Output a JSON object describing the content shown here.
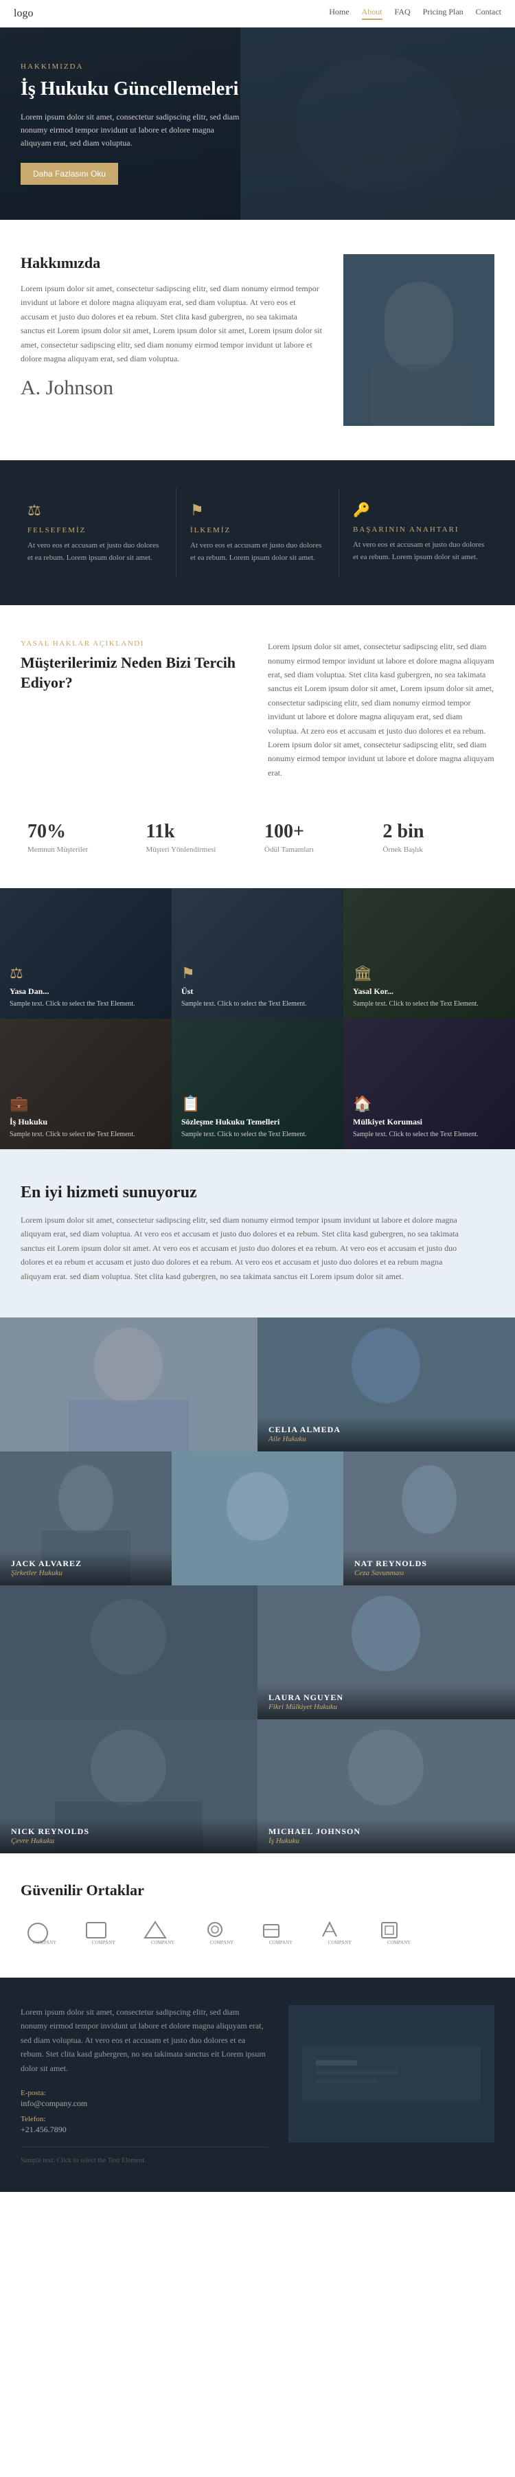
{
  "nav": {
    "logo": "logo",
    "links": [
      "Home",
      "About",
      "FAQ",
      "Pricing Plan",
      "Contact"
    ],
    "active": "About"
  },
  "hero": {
    "tag": "HAKKIMIZDA",
    "title": "İş Hukuku Güncellemeleri",
    "desc": "Lorem ipsum dolor sit amet, consectetur sadipscing elitr, sed diam nonumy eirmod tempor invidunt ut labore et dolore magna aliquyam erat, sed diam voluptua.",
    "btn": "Daha Fazlasını Oku"
  },
  "about": {
    "title": "Hakkımızda",
    "desc1": "Lorem ipsum dolor sit amet, consectetur sadipscing elitr, sed diam nonumy eirmod tempor invidunt ut labore et dolore magna aliquyam erat, sed diam voluptua. At vero eos et accusam et justo duo dolores et ea rebum. Stet clita kasd gubergren, no sea takimata sanctus eit Lorem ipsum dolor sit amet, Lorem ipsum dolor sit amet, Lorem ipsum dolor sit amet, consectetur sadipscing elitr, sed diam nonumy eirmod tempor invidunt ut labore et dolore magna aliquyam erat, sed diam voluptua.",
    "signature": "A. Johnson"
  },
  "pillars": [
    {
      "icon": "scale",
      "title": "FELSEFEMİZ",
      "desc": "At vero eos et accusam et justo duo dolores et ea rebum. Lorem ipsum dolor sit amet."
    },
    {
      "icon": "flag",
      "title": "İLKEMİZ",
      "desc": "At vero eos et accusam et justo duo dolores et ea rebum. Lorem ipsum dolor sit amet."
    },
    {
      "icon": "key",
      "title": "BAŞARININ ANAHTARI",
      "desc": "At vero eos et accusam et justo duo dolores et ea rebum. Lorem ipsum dolor sit amet."
    }
  ],
  "why": {
    "tag": "YASAL HAKLAR AÇIKLANDI",
    "title": "Müşterilerimiz Neden Bizi Tercih Ediyor?",
    "desc": "Lorem ipsum dolor sit amet, consectetur sadipscing elitr, sed diam nonumy eirmod tempor invidunt ut labore et dolore magna aliquyam erat, sed diam voluptua. Stet clita kasd gubergren, no sea takimata sanctus eit Lorem ipsum dolor sit amet, Lorem ipsum dolor sit amet, consectetur sadipscing elitr, sed diam nonumy eirmod tempor invidunt ut labore et dolore magna aliquyam erat, sed diam voluptua. At zero eos et accusam et justo duo dolores et ea rebum. Lorem ipsum dolor sit amet, consectetur sadipscing elitr, sed diam nonumy eirmod tempor invidunt ut labore et dolore magna aliquyam erat."
  },
  "stats": [
    {
      "number": "70%",
      "label": "Memnun Müşteriler"
    },
    {
      "number": "11k",
      "label": "Müşteri Yönlendirmesi"
    },
    {
      "number": "100+",
      "label": "Ödül Tamamları"
    },
    {
      "number": "2 bin",
      "label": "Örnek Başlık"
    }
  ],
  "grid_cards": [
    {
      "title": "Yasa Dan...",
      "sample": "Sample text. Click to select the Text Element.",
      "bg": "grid-bg-1",
      "icon": "⚖"
    },
    {
      "title": "Üst",
      "sample": "Sample text. Click to select the Text Element.",
      "bg": "grid-bg-2",
      "icon": "⚑"
    },
    {
      "title": "Yasal Kor...",
      "sample": "Sample text. Click to select the Text Element.",
      "bg": "grid-bg-3",
      "icon": "🏛"
    },
    {
      "title": "İş Hukuku",
      "sample": "Sample text. Click to select the Text Element.",
      "bg": "grid-bg-4",
      "icon": "💼"
    },
    {
      "title": "Sözleşme Hukuku Temelleri",
      "sample": "Sample text. Click to select the Text Element.",
      "bg": "grid-bg-5",
      "icon": "📋"
    },
    {
      "title": "Mülkiyet Korumasi",
      "sample": "Sample text. Click to select the Text Element.",
      "bg": "grid-bg-6",
      "icon": "🏠"
    }
  ],
  "services": {
    "title": "En iyi hizmeti sunuyoruz",
    "desc": "Lorem ipsum dolor sit amet, consectetur sadipscing elitr, sed diam nonumy eirmod tempor ipsum invidunt ut labore et dolore magna aliquyam erat, sed diam voluptua. At vero eos et accusam et justo duo dolores et ea rebum. Stet clita kasd gubergren, no sea takimata sanctus eit Lorem ipsum dolor sit amet. At vero eos et accusam et justo duo dolores et ea rebum. At vero eos et accusam et justo duo dolores et ea rebum et accusam et justo duo dolores et ea rebum. At vero eos et accusam et justo duo dolores et ea rebum magna aliquyam erat. sed diam voluptua. Stet clita kasd gubergren, no sea takimata sanctus eit Lorem ipsum dolor sit amet."
  },
  "team": [
    {
      "name": "CELIA ALMEDA",
      "role": "Aile Hukuku",
      "bg": "team-bg-1",
      "col": "right"
    },
    {
      "name": "JACK ALVAREZ",
      "role": "Şirketler Hukuku",
      "bg": "team-bg-2",
      "col": "left"
    },
    {
      "name": "NAT REYNOLDS",
      "role": "Ceza Savunması",
      "bg": "team-bg-3",
      "col": "right"
    },
    {
      "name": "LAURA NGUYEN",
      "role": "Fikri Mülkiyet Hukuku",
      "bg": "team-bg-4",
      "col": "center"
    },
    {
      "name": "NICK REYNOLDS",
      "role": "Çevre Hukuku",
      "bg": "team-bg-5",
      "col": "left"
    },
    {
      "name": "MICHAEL JOHNSON",
      "role": "İş Hukuku",
      "bg": "team-bg-6",
      "col": "right"
    }
  ],
  "partners": {
    "title": "Güvenilir Ortaklar",
    "logos": [
      "COMPANY",
      "COMPANY",
      "COMPANY",
      "COMPANY",
      "COMPANY",
      "COMPANY",
      "COMPANY"
    ]
  },
  "contact": {
    "desc": "Lorem ipsum dolor sit amet, consectetur sadipscing elitr, sed diam nonumy eirmod tempor invidunt ut labore et dolore magna aliquyam erat, sed diam voluptua. At vero eos et accusam et justo duo dolores et ea rebum. Stet clita kasd gubergren, no sea takimata sanctus eit Lorem ipsum dolor sit amet.",
    "email_label": "E-posta:",
    "email_value": "info@company.com",
    "phone_label": "Telefon:",
    "phone_value": "+21.456.7890",
    "footer_text": "Sample text. Click to select the Text Element."
  }
}
